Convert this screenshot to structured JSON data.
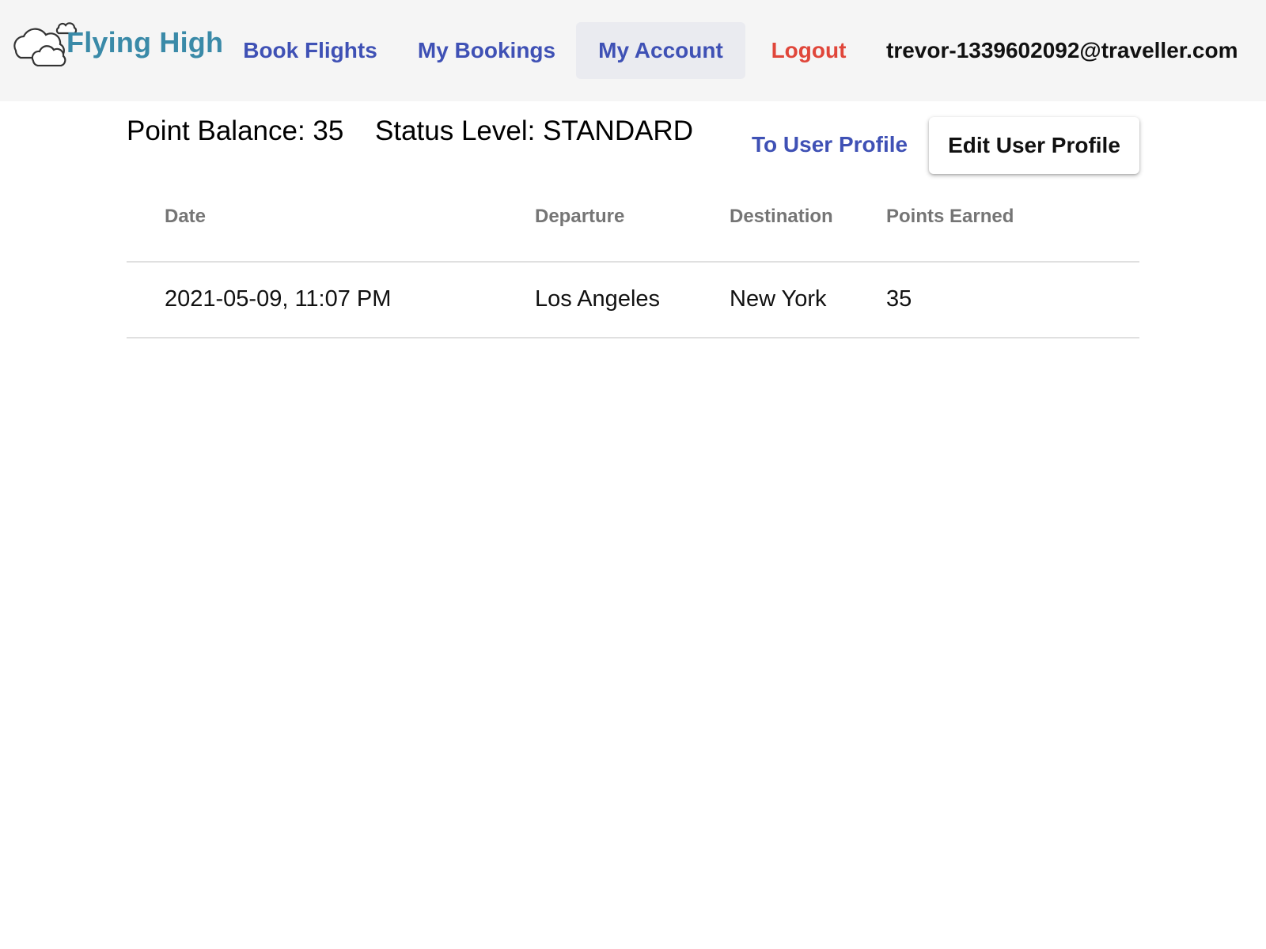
{
  "navbar": {
    "logo_text": "Flying High",
    "links": {
      "book_flights": "Book Flights",
      "my_bookings": "My Bookings",
      "my_account": "My Account",
      "logout": "Logout"
    },
    "user_email": "trevor-1339602092@traveller.com",
    "active_link": "My Account"
  },
  "account": {
    "point_balance": "Point Balance: 35",
    "status_level": "Status Level: STANDARD",
    "to_user_profile": "To User Profile",
    "edit_user_profile": "Edit User Profile"
  },
  "table": {
    "headers": [
      "Date",
      "Departure",
      "Destination",
      "Points Earned"
    ],
    "rows": [
      [
        "2021-05-09, 11:07 PM",
        "Los Angeles",
        "New York",
        "35"
      ]
    ]
  },
  "colors": {
    "link": "#3f51b5",
    "logout": "#e0463a",
    "logo": "#3a8aa8",
    "navbar_bg": "#f5f5f5",
    "active_bg": "#eaebf0"
  }
}
